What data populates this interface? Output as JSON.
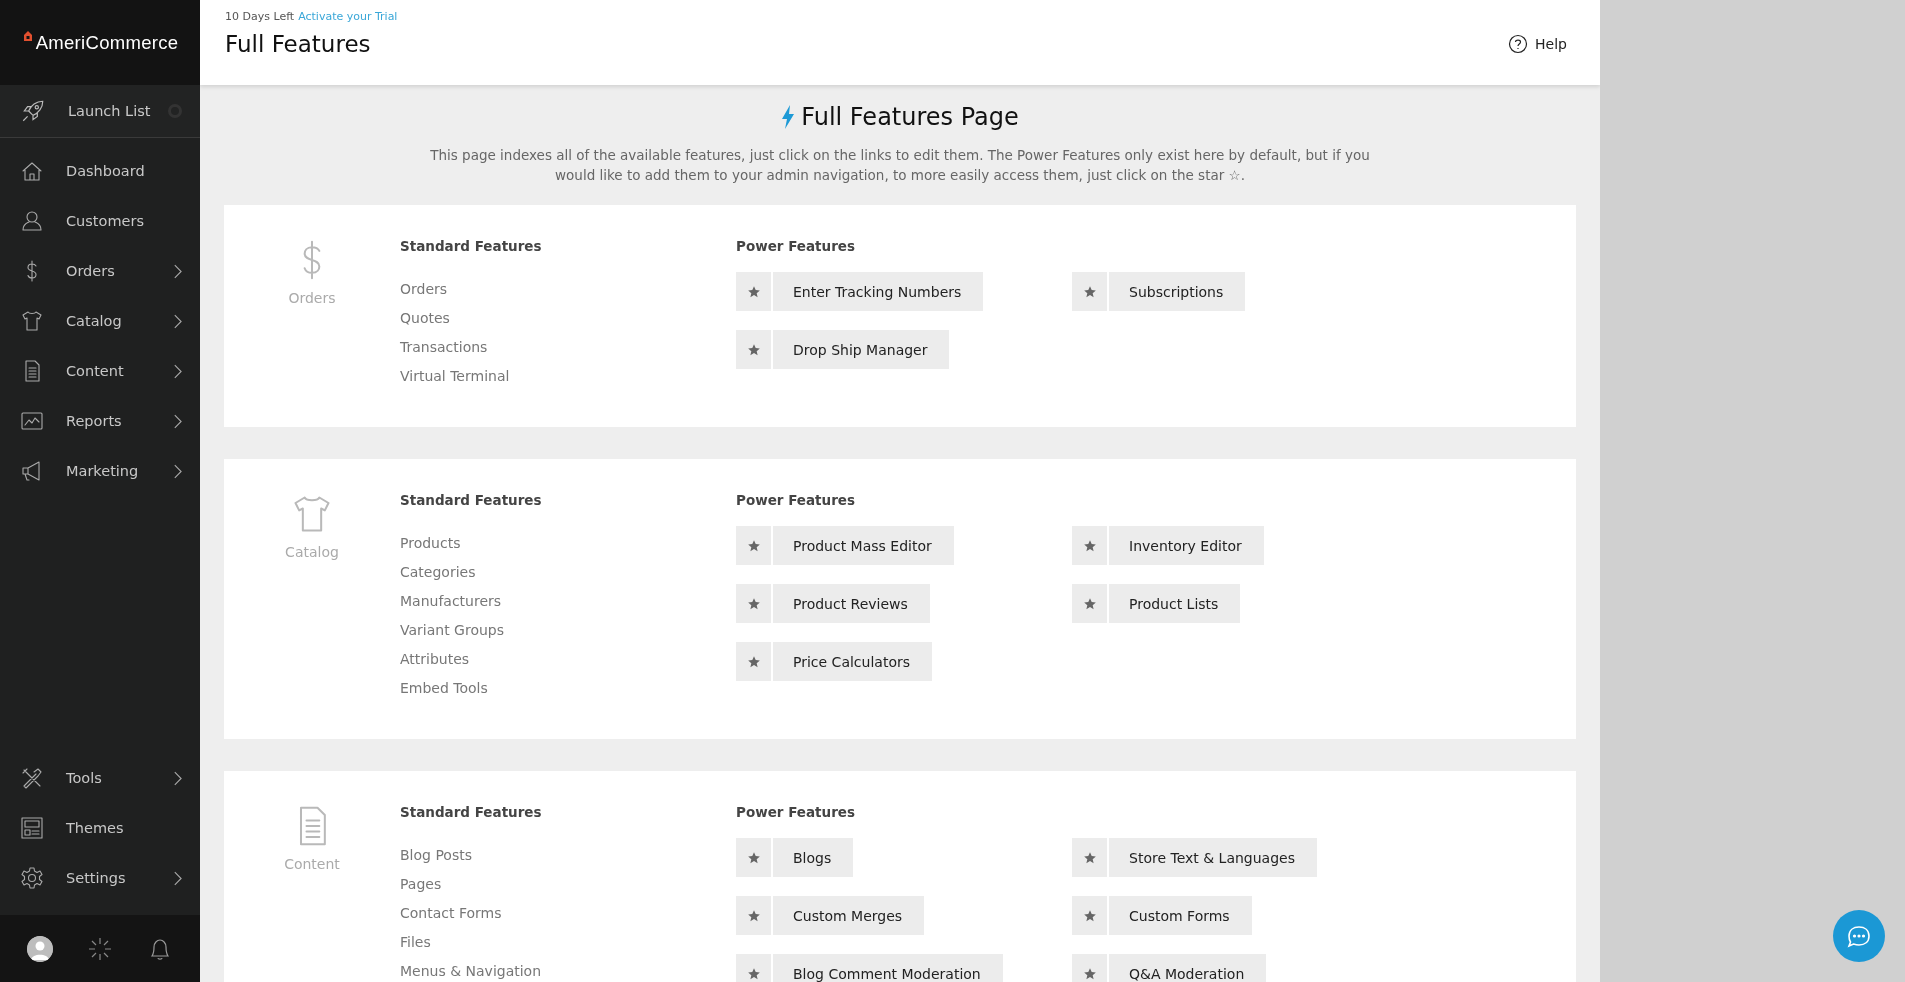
{
  "sidebar": {
    "logo": "AmeriCommerce",
    "launch": {
      "label": "Launch List"
    },
    "items": [
      {
        "label": "Dashboard",
        "has_submenu": false
      },
      {
        "label": "Customers",
        "has_submenu": false
      },
      {
        "label": "Orders",
        "has_submenu": true
      },
      {
        "label": "Catalog",
        "has_submenu": true
      },
      {
        "label": "Content",
        "has_submenu": true
      },
      {
        "label": "Reports",
        "has_submenu": true
      },
      {
        "label": "Marketing",
        "has_submenu": true
      }
    ],
    "bottom_items": [
      {
        "label": "Tools",
        "has_submenu": true
      },
      {
        "label": "Themes",
        "has_submenu": false
      },
      {
        "label": "Settings",
        "has_submenu": true
      }
    ]
  },
  "header": {
    "trial": "10 Days Left",
    "trial_link": "Activate your Trial",
    "title": "Full Features",
    "help": "Help"
  },
  "page": {
    "heading": "Full Features Page",
    "intro": "This page indexes all of the available features, just click on the links to edit them. The Power Features only exist here by default, but if you would like to add them to your admin navigation, to more easily access them, just click on the star ☆.",
    "sections": [
      {
        "name": "Orders",
        "standard_heading": "Standard Features",
        "power_heading": "Power Features",
        "standard": [
          "Orders",
          "Quotes",
          "Transactions",
          "Virtual Terminal"
        ],
        "power": [
          "Enter Tracking Numbers",
          "Subscriptions",
          "Drop Ship Manager"
        ]
      },
      {
        "name": "Catalog",
        "standard_heading": "Standard Features",
        "power_heading": "Power Features",
        "standard": [
          "Products",
          "Categories",
          "Manufacturers",
          "Variant Groups",
          "Attributes",
          "Embed Tools"
        ],
        "power": [
          "Product Mass Editor",
          "Inventory Editor",
          "Product Reviews",
          "Product Lists",
          "Price Calculators"
        ]
      },
      {
        "name": "Content",
        "standard_heading": "Standard Features",
        "power_heading": "Power Features",
        "standard": [
          "Blog Posts",
          "Pages",
          "Contact Forms",
          "Files",
          "Menus & Navigation"
        ],
        "power": [
          "Blogs",
          "Store Text & Languages",
          "Custom Merges",
          "Custom Forms",
          "Blog Comment Moderation",
          "Q&A Moderation"
        ]
      }
    ]
  }
}
